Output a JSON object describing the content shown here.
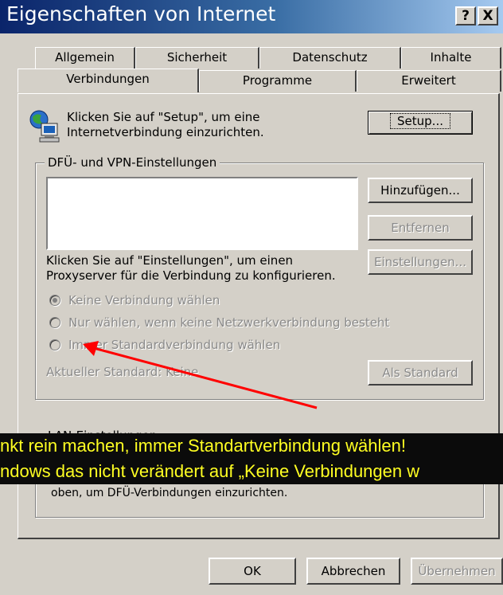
{
  "window": {
    "title": "Eigenschaften von Internet",
    "help_button": "?",
    "close_button": "X"
  },
  "tabs": {
    "row1": [
      "Allgemein",
      "Sicherheit",
      "Datenschutz",
      "Inhalte"
    ],
    "row2": [
      "Verbindungen",
      "Programme",
      "Erweitert"
    ],
    "active": "Verbindungen"
  },
  "setup": {
    "text_line1": "Klicken Sie auf \"Setup\", um eine",
    "text_line2": "Internetverbindung einzurichten.",
    "button": "Setup..."
  },
  "dialup": {
    "legend": "DFÜ- und VPN-Einstellungen",
    "add_button": "Hinzufügen...",
    "remove_button": "Entfernen",
    "settings_button": "Einstellungen...",
    "proxy_text_line1": "Klicken Sie auf \"Einstellungen\", um einen",
    "proxy_text_line2": "Proxyserver für die Verbindung zu konfigurieren.",
    "radio_options": [
      "Keine Verbindung wählen",
      "Nur wählen, wenn keine Netzwerkverbindung besteht",
      "Immer Standardverbindung wählen"
    ],
    "selected_index": 0,
    "current_default_label": "Aktueller Standard:",
    "current_default_value": "Keine",
    "set_default_button": "Als Standard"
  },
  "lan": {
    "legend": "LAN-Einstellungen",
    "text": "oben, um DFÜ-Verbindungen einzurichten."
  },
  "overlay": {
    "line1": "nkt rein machen, immer Standartverbindung wählen!",
    "line2": "ndows das nicht verändert auf „Keine Verbindungen w"
  },
  "footer": {
    "ok_button": "OK",
    "cancel_button": "Abbrechen",
    "apply_button": "Übernehmen"
  },
  "colors": {
    "dialog_bg": "#d4d0c8",
    "titlebar_dark": "#0a246a",
    "titlebar_light": "#a6caf0",
    "annotation_arrow": "#ff0000",
    "overlay_text": "#ffff22",
    "overlay_bg": "#0b0b0b"
  },
  "icons": {
    "setup_icon": "globe-computer-icon"
  }
}
